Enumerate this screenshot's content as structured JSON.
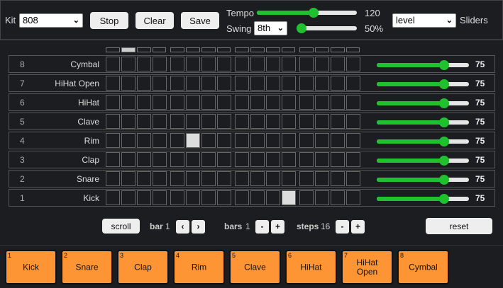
{
  "toolbar": {
    "kit_label": "Kit",
    "kit_value": "808",
    "stop": "Stop",
    "clear": "Clear",
    "save": "Save",
    "tempo_label": "Tempo",
    "tempo_value": "120",
    "tempo_fraction": 0.57,
    "swing_label": "Swing",
    "swing_select": "8th",
    "swing_value": "50%",
    "swing_fraction": 0.0,
    "sliders_select": "level",
    "sliders_label": "Sliders"
  },
  "playhead_step": 1,
  "steps": 16,
  "rows": [
    {
      "num": "8",
      "name": "Cymbal",
      "active": [],
      "level": "75",
      "fraction": 0.73
    },
    {
      "num": "7",
      "name": "HiHat Open",
      "active": [],
      "level": "75",
      "fraction": 0.73
    },
    {
      "num": "6",
      "name": "HiHat",
      "active": [],
      "level": "75",
      "fraction": 0.73
    },
    {
      "num": "5",
      "name": "Clave",
      "active": [],
      "level": "75",
      "fraction": 0.73
    },
    {
      "num": "4",
      "name": "Rim",
      "active": [
        5
      ],
      "level": "75",
      "fraction": 0.73
    },
    {
      "num": "3",
      "name": "Clap",
      "active": [],
      "level": "75",
      "fraction": 0.73
    },
    {
      "num": "2",
      "name": "Snare",
      "active": [],
      "level": "75",
      "fraction": 0.73
    },
    {
      "num": "1",
      "name": "Kick",
      "active": [
        11
      ],
      "level": "75",
      "fraction": 0.73
    }
  ],
  "controls": {
    "scroll": "scroll",
    "bar_label": "bar",
    "bar_value": "1",
    "prev": "‹",
    "next": "›",
    "bars_label": "bars",
    "bars_value": "1",
    "minus": "-",
    "plus": "+",
    "steps_label": "steps",
    "steps_value": "16",
    "reset": "reset"
  },
  "pads": [
    {
      "num": "1",
      "label": "Kick"
    },
    {
      "num": "2",
      "label": "Snare"
    },
    {
      "num": "3",
      "label": "Clap"
    },
    {
      "num": "4",
      "label": "Rim"
    },
    {
      "num": "5",
      "label": "Clave"
    },
    {
      "num": "6",
      "label": "HiHat"
    },
    {
      "num": "7",
      "label": "HiHat\nOpen"
    },
    {
      "num": "8",
      "label": "Cymbal"
    }
  ]
}
